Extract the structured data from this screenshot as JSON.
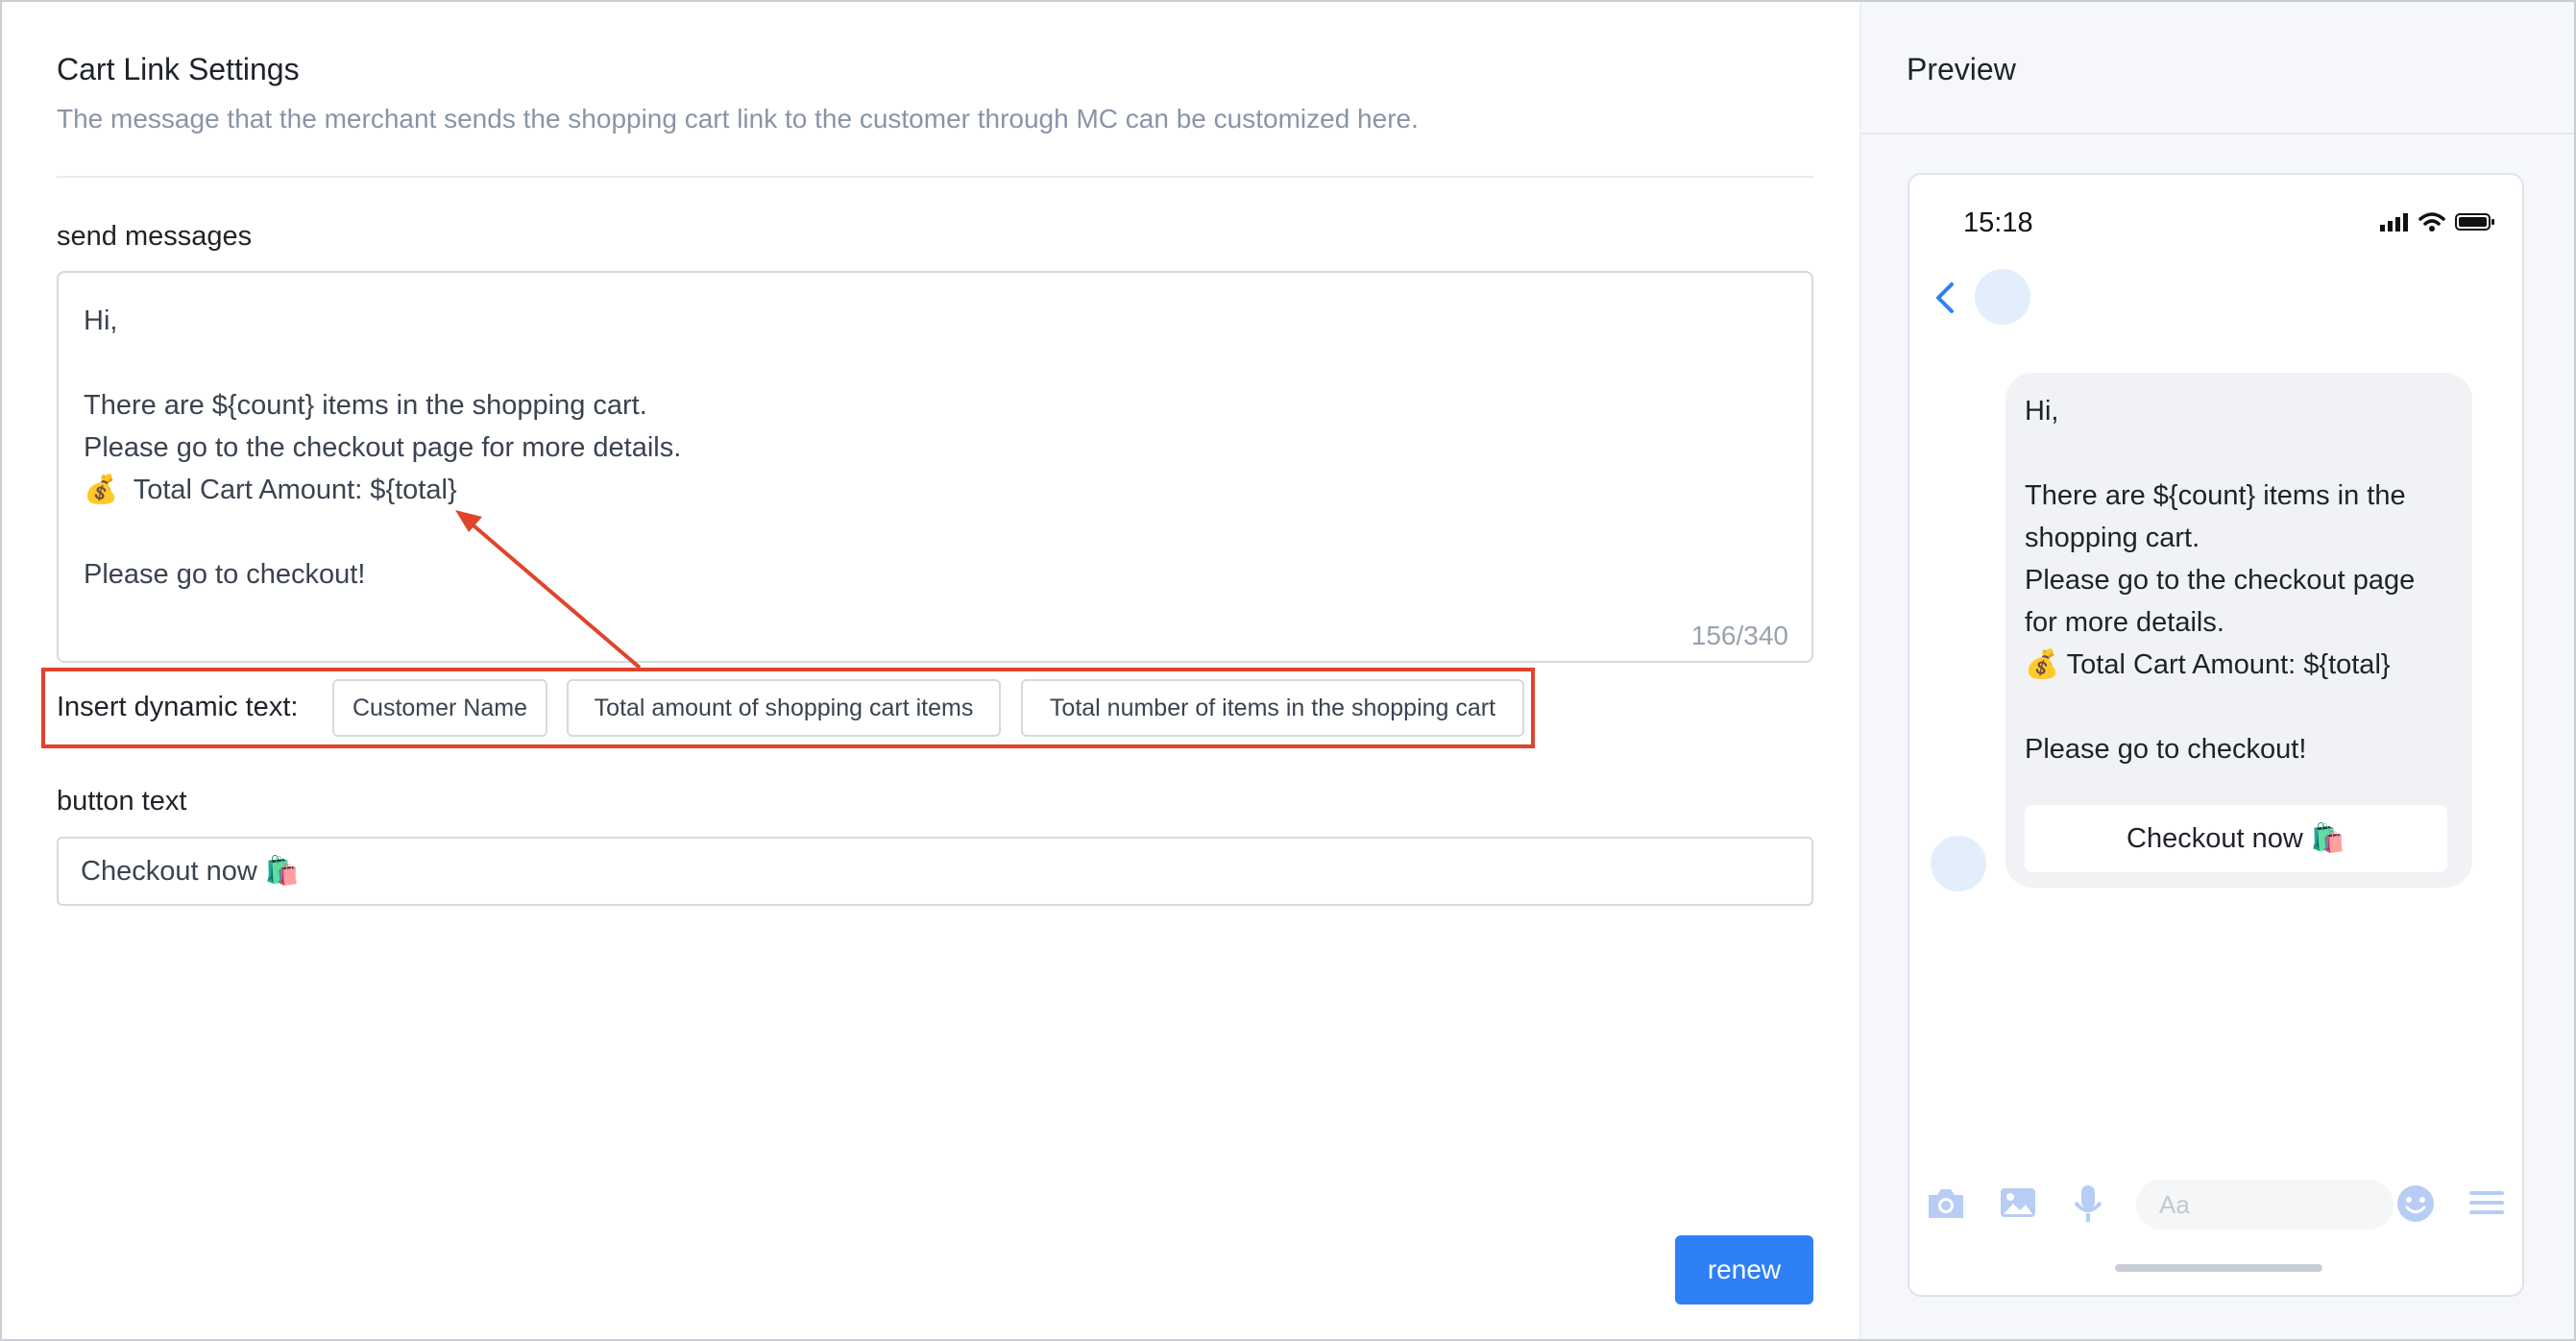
{
  "settings": {
    "title": "Cart Link Settings",
    "description": "The message that the merchant sends the shopping cart link to the customer through MC can be customized here.",
    "send_messages_label": "send messages",
    "message_text": "Hi,\n\nThere are ${count} items in the shopping cart.\nPlease go to the checkout page for more details.\n💰  Total Cart Amount: ${total}\n\nPlease go to checkout!",
    "char_counter": "156/340",
    "insert_dynamic_label": "Insert dynamic text:",
    "dynamic_chips": [
      "Customer Name",
      "Total amount of shopping cart items",
      "Total number of items in the shopping cart"
    ],
    "button_text_label": "button text",
    "button_text_value": "Checkout now 🛍️",
    "renew_label": "renew"
  },
  "preview": {
    "title": "Preview",
    "status_time": "15:18",
    "bubble_text": "Hi,\n\nThere are ${count} items in the shopping cart.\nPlease go to the checkout page for more details.\n💰 Total Cart Amount: ${total}\n\nPlease go to checkout!",
    "bubble_button": "Checkout now 🛍️",
    "input_placeholder": "Aa"
  },
  "colors": {
    "accent": "#2f80f7",
    "highlight": "#e0442b",
    "icon": "#b7cdf5"
  },
  "icons": [
    "back-icon",
    "camera-icon",
    "image-icon",
    "mic-icon",
    "emoji-icon",
    "menu-icon",
    "signal-icon",
    "wifi-icon",
    "battery-icon",
    "annotation-arrow"
  ]
}
